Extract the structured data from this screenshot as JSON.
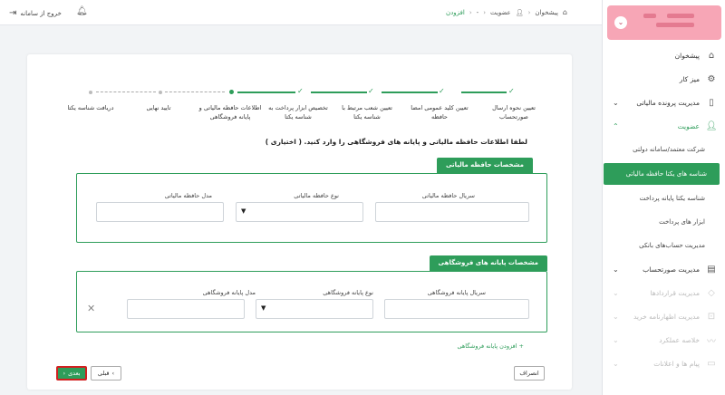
{
  "topbar": {
    "logout_label": "خروج از سامانه",
    "breadcrumb": [
      "پیشخوان",
      "عضویت",
      "-",
      "افزودن"
    ]
  },
  "sidebar": {
    "items": [
      {
        "label": "پیشخوان",
        "icon": "home-icon"
      },
      {
        "label": "میز کار",
        "icon": "gears-icon"
      },
      {
        "label": "مدیریت پرونده مالیاتی",
        "icon": "file-icon"
      },
      {
        "label": "عضویت",
        "icon": "user-icon"
      }
    ],
    "membership_sub": [
      "شرکت معتمد/سامانه دولتی",
      "شناسه های یکتا حافظه مالیاتی",
      "شناسه یکتا پایانه پرداخت",
      "ابزار های پرداخت",
      "مدیریت حساب‌های بانکی"
    ],
    "after_items": [
      {
        "label": "مدیریت صورتحساب",
        "icon": "invoice-icon"
      },
      {
        "label": "مدیریت قراردادها",
        "icon": "handshake-icon"
      },
      {
        "label": "مدیریت اظهارنامه خرید",
        "icon": "cart-icon"
      },
      {
        "label": "خلاصه عملکرد",
        "icon": "chart-icon"
      },
      {
        "label": "پیام ها و اعلانات",
        "icon": "message-icon"
      }
    ]
  },
  "stepper": {
    "steps": [
      "تعیین نحوه ارسال صورتحساب",
      "تعیین کلید عمومی امضا حافظه",
      "تعیین شعب مرتبط با شناسه یکتا",
      "تخصیص ابزار پرداخت به شناسه یکتا",
      "اطلاعات حافظه مالیاتی و پایانه فروشگاهی",
      "تایید نهایی",
      "دریافت شناسه یکتا"
    ]
  },
  "form": {
    "intro": "لطفا اطلاعات حافظه مالیاتی و پایانه های فروشگاهی را وارد کنید. ( اختیاری )",
    "memory_section": {
      "title": "مشخصات حافظه مالیاتی",
      "serial_label": "سریال حافظه مالیاتی",
      "type_label": "نوع حافظه مالیاتی",
      "model_label": "مدل حافظه مالیاتی"
    },
    "terminal_section": {
      "title": "مشخصات پایانه های فروشگاهی",
      "serial_label": "سریال پایانه فروشگاهی",
      "type_label": "نوع پایانه فروشگاهی",
      "model_label": "مدل پایانه فروشگاهی"
    },
    "add_terminal": "افزودن پایانه فروشگاهی"
  },
  "buttons": {
    "next": "بعدی",
    "prev": "قبلی",
    "cancel": "انصراف"
  },
  "colors": {
    "accent": "#2e9d5a",
    "highlight": "#d22020",
    "profile": "#f7a6b6"
  }
}
